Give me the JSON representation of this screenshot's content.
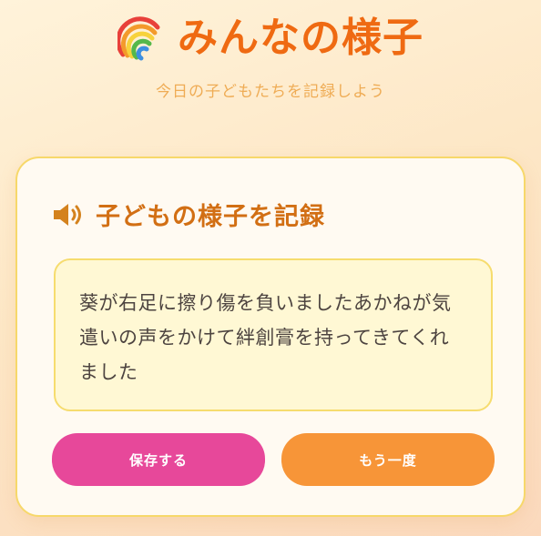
{
  "header": {
    "icon": "rainbow-icon",
    "title": "みんなの様子",
    "subtitle": "今日の子どもたちを記録しよう"
  },
  "record": {
    "icon": "speaker-icon",
    "title": "子どもの様子を記録",
    "note_text": "葵が右足に擦り傷を負いましたあかねが気遣いの声をかけて絆創膏を持ってきてくれました"
  },
  "buttons": {
    "save_label": "保存する",
    "retry_label": "もう一度"
  },
  "colors": {
    "title": "#ef6a12",
    "subtitle": "#efac55",
    "section_title": "#d26f14",
    "save_button": "#e7489a",
    "retry_button": "#f79538",
    "card_border": "#f7d86a",
    "note_background": "#fff8d4"
  }
}
